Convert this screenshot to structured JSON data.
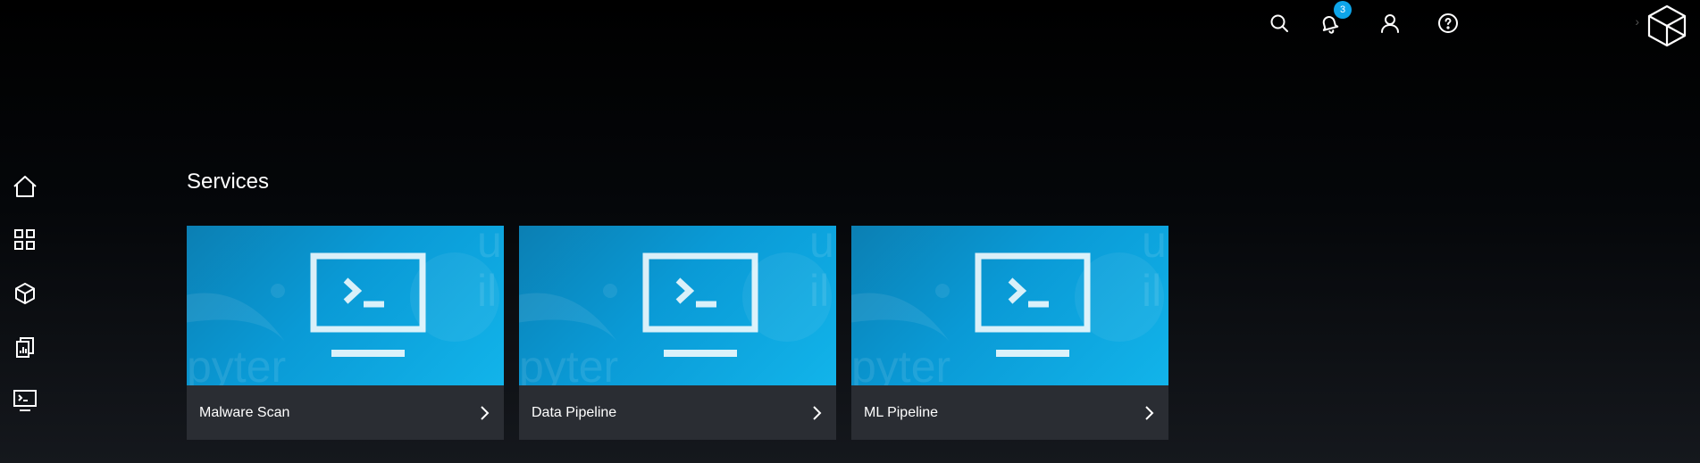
{
  "topbar": {
    "icons": [
      "search-icon",
      "bell-icon",
      "user-icon",
      "help-icon"
    ],
    "notification_count": "3",
    "user_menu_label": "",
    "logo_icon": "cube-logo"
  },
  "sidebar": {
    "items": [
      {
        "icon": "home-icon"
      },
      {
        "icon": "grid-icon"
      },
      {
        "icon": "cube-icon"
      },
      {
        "icon": "reports-icon"
      },
      {
        "icon": "terminal-icon"
      }
    ]
  },
  "main": {
    "section_title": "Services",
    "cards": [
      {
        "label": "Malware Scan",
        "icon": "terminal-monitor-icon"
      },
      {
        "label": "Data Pipeline",
        "icon": "terminal-monitor-icon"
      },
      {
        "label": "ML Pipeline",
        "icon": "terminal-monitor-icon"
      }
    ]
  },
  "colors": {
    "accent": "#0ea5e9",
    "card_footer": "#2a2d33",
    "thumb_blue": "#0a9ad6",
    "background": "#000000"
  }
}
